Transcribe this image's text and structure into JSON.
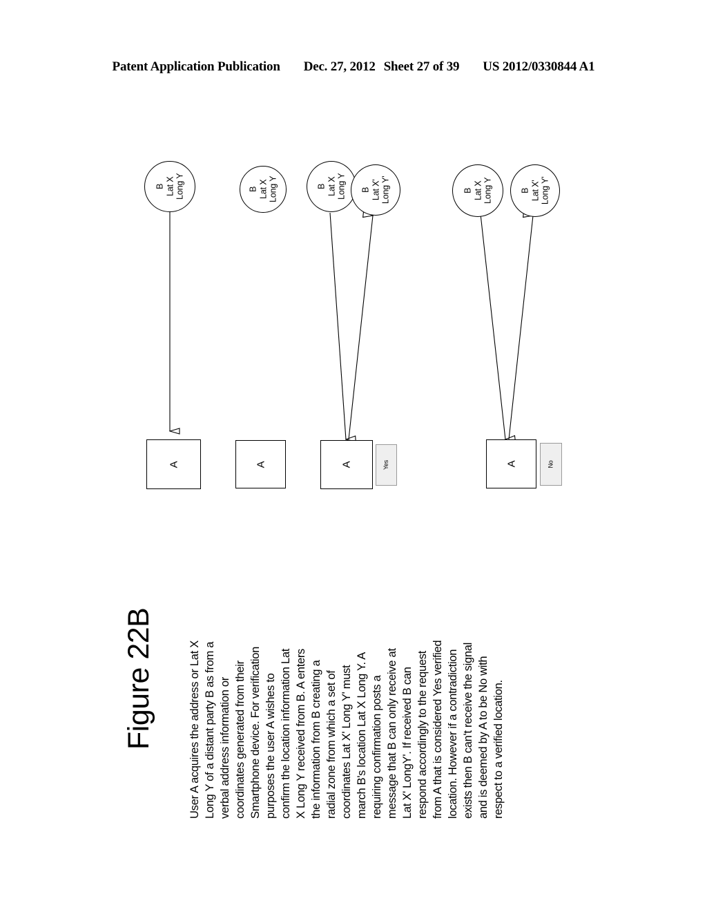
{
  "header": {
    "publication": "Patent Application Publication",
    "date": "Dec. 27, 2012",
    "sheet": "Sheet 27 of 39",
    "number": "US 2012/0330844 A1"
  },
  "figure": {
    "title": "Figure 22B"
  },
  "diagram": {
    "groups": [
      {
        "name": "group-1",
        "circles": [
          {
            "line1": "B",
            "line2": "Lat X",
            "line3": "Long Y"
          }
        ],
        "box_label": "A",
        "answer_label": null
      },
      {
        "name": "group-2",
        "circles": [
          {
            "line1": "B",
            "line2": "Lat X",
            "line3": "Long Y"
          }
        ],
        "box_label": "A",
        "answer_label": null
      },
      {
        "name": "group-3",
        "circles": [
          {
            "line1": "B",
            "line2": "Lat X",
            "line3": "Long Y"
          },
          {
            "line1": "B",
            "line2": "Lat X'",
            "line3": "Long Y'"
          }
        ],
        "box_label": "A",
        "answer_label": "Yes"
      },
      {
        "name": "group-4",
        "circles": [
          {
            "line1": "B",
            "line2": "Lat X",
            "line3": "Long Y"
          },
          {
            "line1": "B",
            "line2": "Lat X'",
            "line3": "Long Y'"
          }
        ],
        "box_label": "A",
        "answer_label": "No"
      }
    ]
  },
  "caption": {
    "lines": [
      "User A acquires the address or Lat X",
      "Long Y of a distant party B as from a",
      "verbal address information or",
      "coordinates generated from their",
      "Smartphone device.  For verification",
      "purposes the user A wishes to",
      "confirm the location information Lat",
      "X Long Y received from B. A enters",
      "the information from B creating a",
      "radial zone from which a set of",
      "coordinates Lat X' Long Y' must",
      "march B's location Lat X Long Y.  A",
      "requiring confirmation posts a",
      "message that B can only receive at",
      "Lat X' LongY'. If received B can",
      "respond accordingly to the request",
      "from A that is considered Yes verified",
      "location. However if a contradiction",
      "exists then B can't receive the signal",
      "and is deemed by A to be No with",
      "respect to a verified location."
    ]
  }
}
